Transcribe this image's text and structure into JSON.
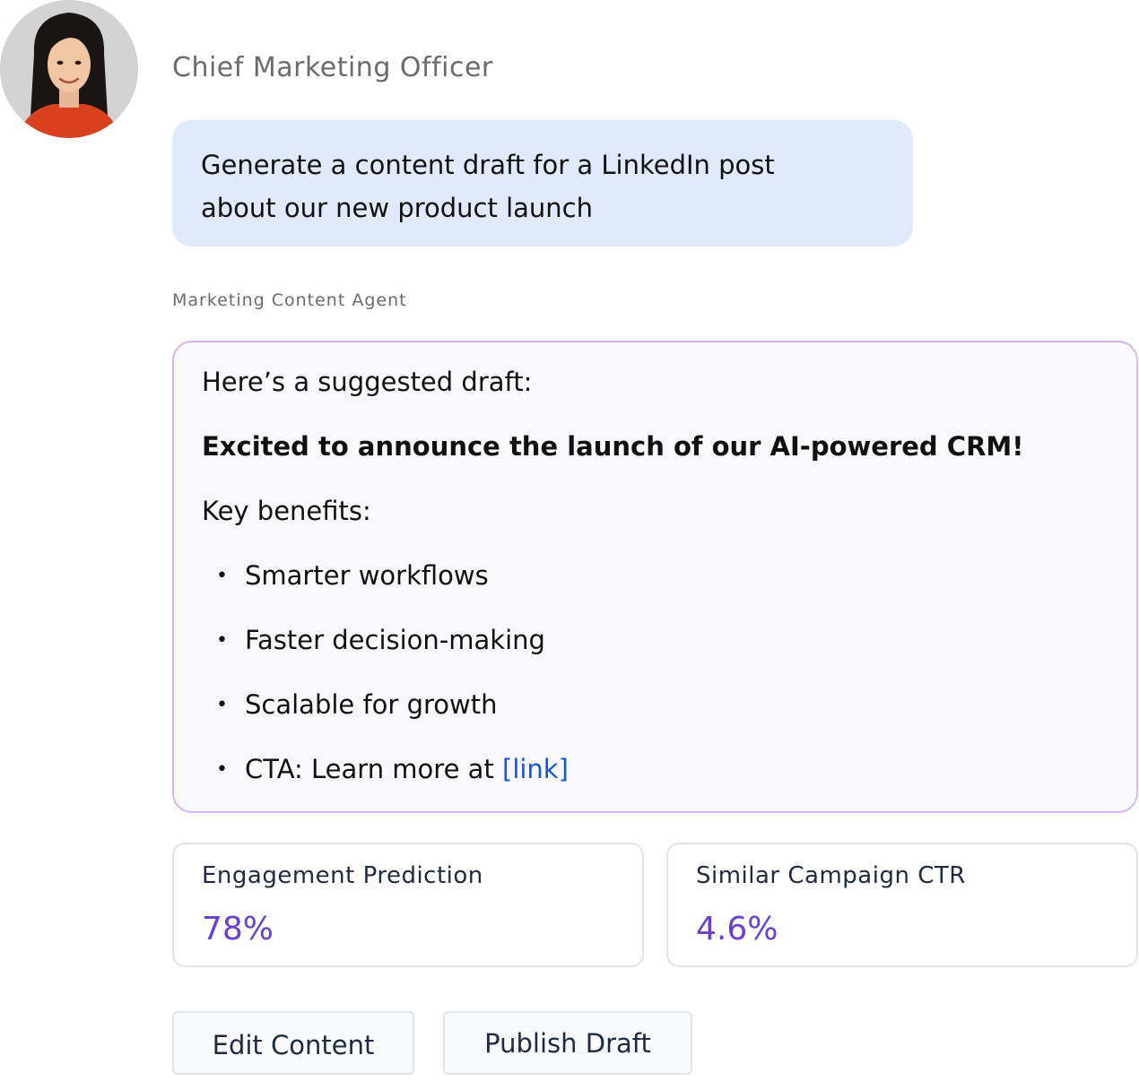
{
  "user": {
    "role": "Chief Marketing Officer",
    "avatar_icon": "person-portrait-icon",
    "message_line1": "Generate a content draft for a LinkedIn post",
    "message_line2": "about our new product launch"
  },
  "agent": {
    "name": "Marketing Content Agent",
    "intro": "Here’s a suggested draft:",
    "headline": "Excited to announce the launch of our AI-powered CRM!",
    "benefits_label": "Key benefits:",
    "bullets": [
      "Smarter workflows",
      "Faster decision-making",
      "Scalable for growth",
      "CTA: Learn more at "
    ],
    "link_text": "[link]"
  },
  "metrics": [
    {
      "label": "Engagement Prediction",
      "value": "78%"
    },
    {
      "label": "Similar Campaign CTR",
      "value": "4.6%"
    }
  ],
  "actions": {
    "edit_label": "Edit Content",
    "publish_label": "Publish Draft"
  },
  "colors": {
    "user_bubble_bg": "#e1eafb",
    "agent_card_border": "#d5b6f2",
    "metric_value": "#6a3fd1",
    "link": "#1a56db"
  }
}
